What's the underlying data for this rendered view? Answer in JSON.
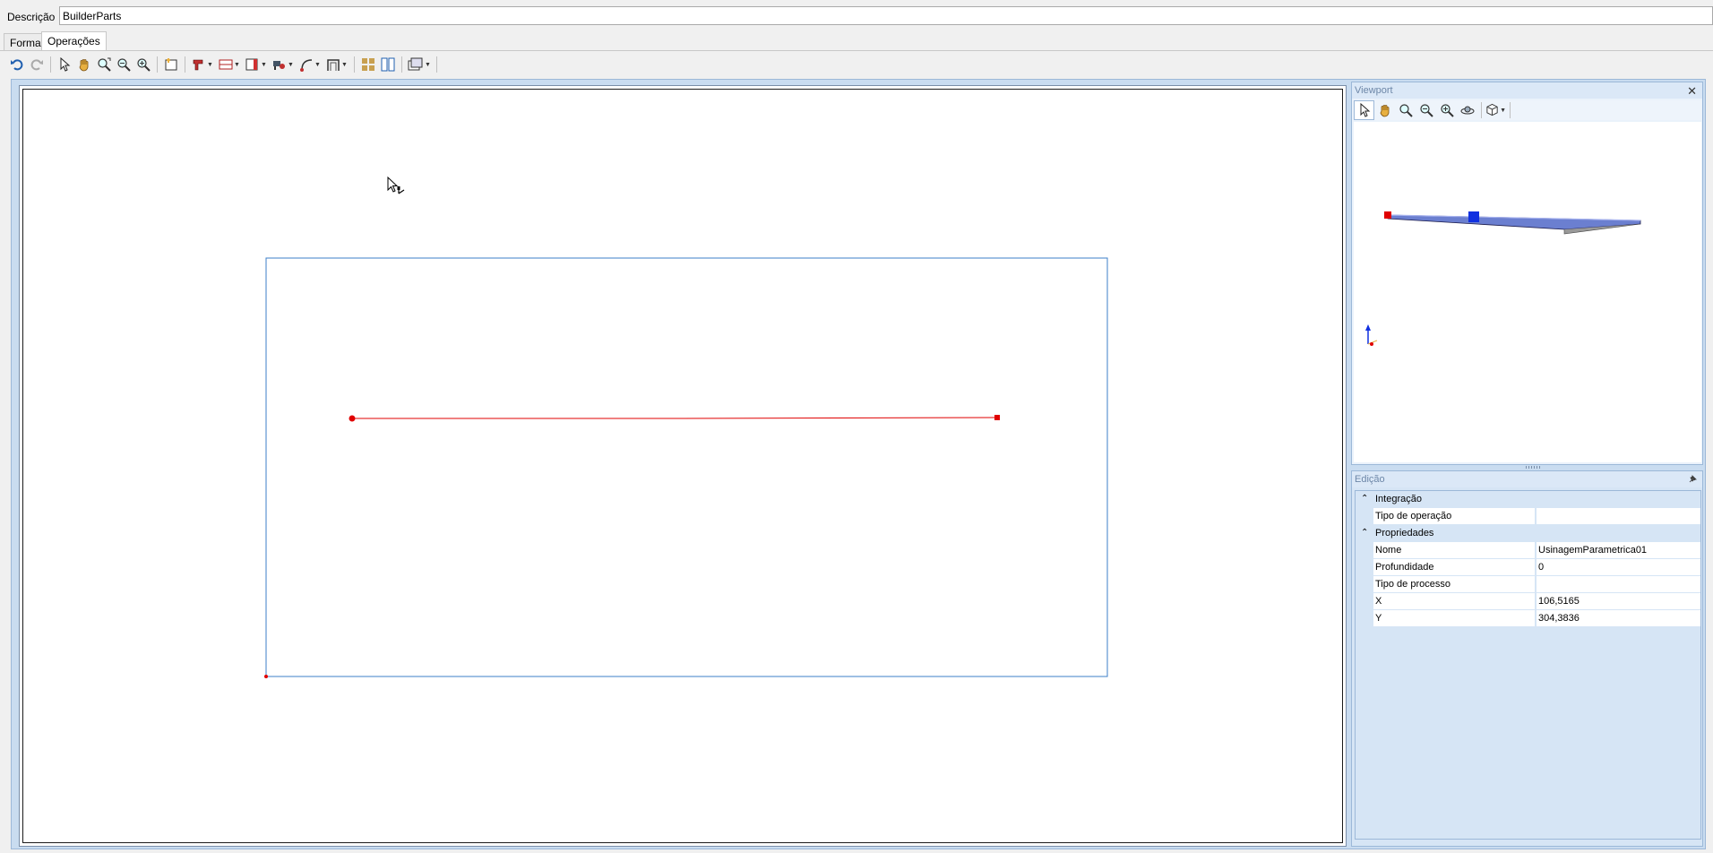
{
  "header": {
    "description_label": "Descrição",
    "description_value": "BuilderParts"
  },
  "tabs": [
    {
      "label": "Forma",
      "active": false
    },
    {
      "label": "Operações",
      "active": true
    }
  ],
  "toolbar": {
    "icons": [
      "undo-icon",
      "redo-icon",
      "select-arrow-icon",
      "pan-hand-icon",
      "zoom-extents-icon",
      "zoom-out-icon",
      "zoom-in-icon",
      "new-operation-icon",
      "drill-icon",
      "cut-icon",
      "pocket-icon",
      "router-icon",
      "path-icon",
      "profile-icon",
      "group-icon",
      "split-icon",
      "view-options-icon"
    ]
  },
  "viewport_panel": {
    "title": "Viewport",
    "icons": [
      "select-arrow-icon",
      "pan-hand-icon",
      "zoom-extents-icon",
      "zoom-out-icon",
      "zoom-in-icon",
      "orbit-icon",
      "view-cube-icon"
    ]
  },
  "edit_panel": {
    "title": "Edição",
    "categories": [
      {
        "label": "Integração",
        "properties": [
          {
            "name": "Tipo de operação",
            "value": ""
          }
        ]
      },
      {
        "label": "Propriedades",
        "properties": [
          {
            "name": "Nome",
            "value": "UsinagemParametrica01"
          },
          {
            "name": "Profundidade",
            "value": "0"
          },
          {
            "name": "Tipo de processo",
            "value": ""
          },
          {
            "name": "X",
            "value": "106,5165"
          },
          {
            "name": "Y",
            "value": "304,3836"
          }
        ]
      }
    ]
  },
  "colors": {
    "path_line": "#e00000",
    "part_outline": "#3c7fc8",
    "frame": "#c9dcf0",
    "panel_title_text": "#6d87a8"
  }
}
